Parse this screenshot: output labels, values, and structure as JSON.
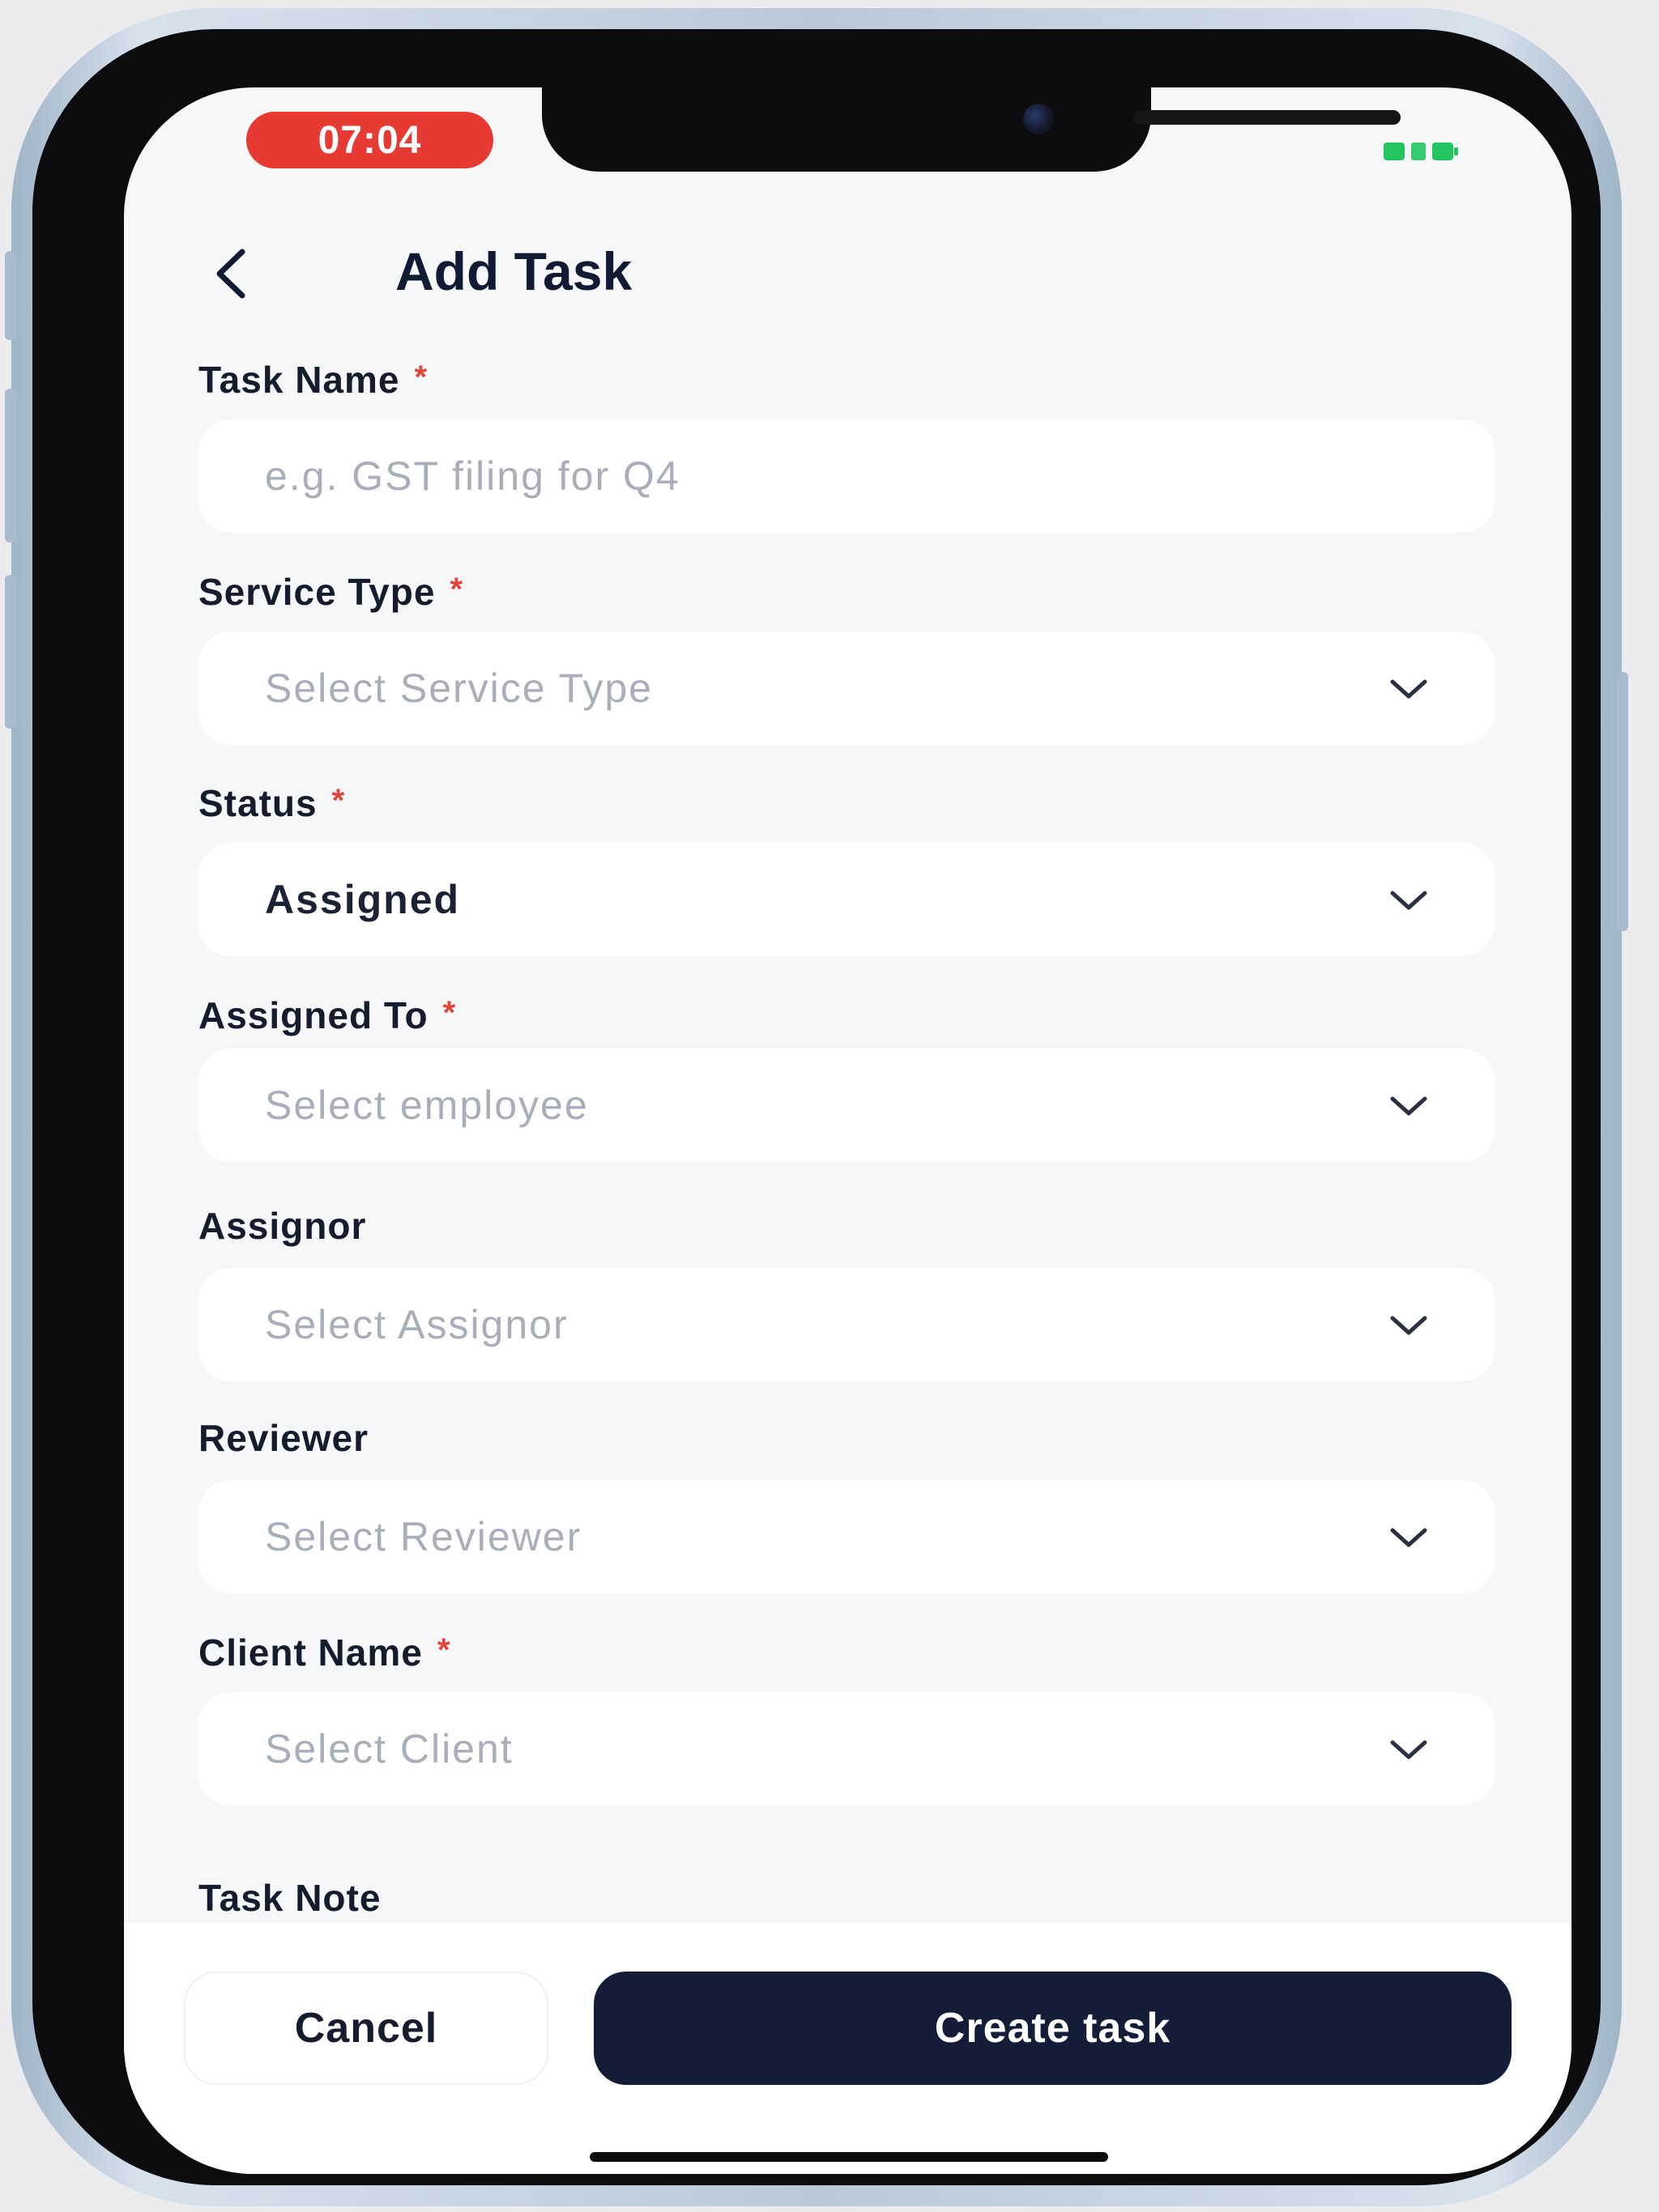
{
  "status_bar": {
    "time": "07:04",
    "battery_icon": "battery-charging-icon",
    "time_pill_color": "#e63a32",
    "battery_color": "#22c55e"
  },
  "header": {
    "back_icon": "chevron-left-icon",
    "title": "Add Task"
  },
  "form": {
    "task_name": {
      "label": "Task Name",
      "required_mark": "*",
      "placeholder": "e.g. GST filing for Q4"
    },
    "service_type": {
      "label": "Service Type",
      "required_mark": "*",
      "value": "Select Service Type"
    },
    "status": {
      "label": "Status",
      "required_mark": "*",
      "value": "Assigned"
    },
    "assigned_to": {
      "label": "Assigned To",
      "required_mark": "*",
      "value": "Select employee"
    },
    "assignor": {
      "label": "Assignor",
      "value": "Select Assignor"
    },
    "reviewer": {
      "label": "Reviewer",
      "value": "Select Reviewer"
    },
    "client_name": {
      "label": "Client Name",
      "required_mark": "*",
      "value": "Select Client"
    },
    "task_note": {
      "label": "Task Note"
    }
  },
  "footer": {
    "cancel_label": "Cancel",
    "create_label": "Create task",
    "primary_color": "#141d37"
  }
}
